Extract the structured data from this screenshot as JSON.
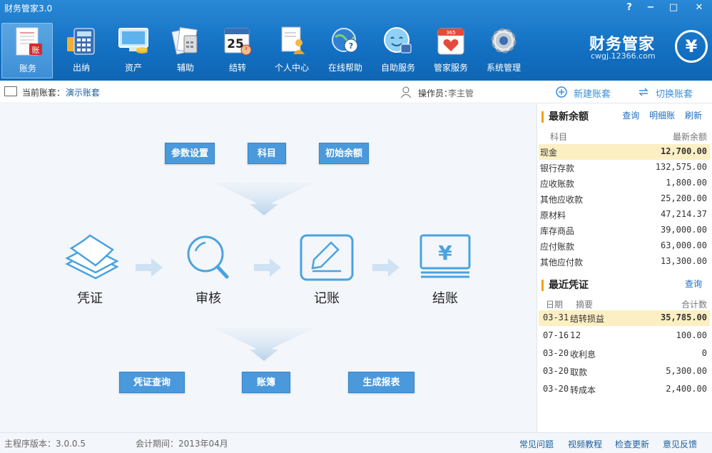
{
  "window": {
    "title": "财务管家3.0",
    "help": "?",
    "min": "−",
    "max": "□",
    "close": "✕"
  },
  "nav": [
    {
      "label": "账务",
      "icon": "ledger-icon"
    },
    {
      "label": "出纳",
      "icon": "calculator-icon"
    },
    {
      "label": "资产",
      "icon": "assets-icon"
    },
    {
      "label": "辅助",
      "icon": "auxiliary-icon"
    },
    {
      "label": "结转",
      "icon": "calendar-icon"
    },
    {
      "label": "个人中心",
      "icon": "personal-center-icon"
    },
    {
      "label": "在线帮助",
      "icon": "online-help-icon"
    },
    {
      "label": "自助服务",
      "icon": "self-service-icon"
    },
    {
      "label": "管家服务",
      "icon": "butler-service-icon"
    },
    {
      "label": "系统管理",
      "icon": "gear-icon"
    }
  ],
  "logo": {
    "name": "财务管家",
    "site": "cwgj.12366.com",
    "badge": "¥"
  },
  "account": {
    "label": "当前账套：",
    "value": "演示账套",
    "operator_label": "操作员：",
    "operator_value": "李主管",
    "new_label": "新建账套",
    "switch_label": "切换账套"
  },
  "flow": {
    "top_buttons": [
      "参数设置",
      "科目",
      "初始余额"
    ],
    "steps": [
      "凭证",
      "审核",
      "记账",
      "结账"
    ],
    "bottom_buttons": [
      "凭证查询",
      "账簿",
      "生成报表"
    ],
    "calendar_day": "25",
    "calendar_badge": "365"
  },
  "balances": {
    "title": "最新余额",
    "links": [
      "查询",
      "明细账",
      "刷新"
    ],
    "col_subject": "科目",
    "col_balance": "最新余额",
    "rows": [
      {
        "name": "现金",
        "value": "12,700.00"
      },
      {
        "name": "银行存款",
        "value": "132,575.00"
      },
      {
        "name": "应收账款",
        "value": "1,800.00"
      },
      {
        "name": "其他应收款",
        "value": "25,200.00"
      },
      {
        "name": "原材料",
        "value": "47,214.37"
      },
      {
        "name": "库存商品",
        "value": "39,000.00"
      },
      {
        "name": "应付账款",
        "value": "63,000.00"
      },
      {
        "name": "其他应付款",
        "value": "13,300.00"
      }
    ]
  },
  "vouchers": {
    "title": "最近凭证",
    "link": "查询",
    "col_date": "日期",
    "col_summary": "摘要",
    "col_total": "合计数",
    "rows": [
      {
        "date": "03-31",
        "summary": "结转损益",
        "total": "35,785.00"
      },
      {
        "date": "07-16",
        "summary": "12",
        "total": "100.00"
      },
      {
        "date": "03-20",
        "summary": "收利息",
        "total": "0"
      },
      {
        "date": "03-20",
        "summary": "取款",
        "total": "5,300.00"
      },
      {
        "date": "03-20",
        "summary": "转成本",
        "total": "2,400.00"
      }
    ]
  },
  "status": {
    "version": "主程序版本：3.0.0.5",
    "period": "会计期间：2013年04月",
    "links": [
      "常见问题",
      "视频教程",
      "检查更新",
      "意见反馈"
    ]
  },
  "colors": {
    "title_bar": "#1370c2",
    "accent": "#4a99dc",
    "highlight_row": "#fcefc4",
    "link": "#1b6ec2"
  }
}
